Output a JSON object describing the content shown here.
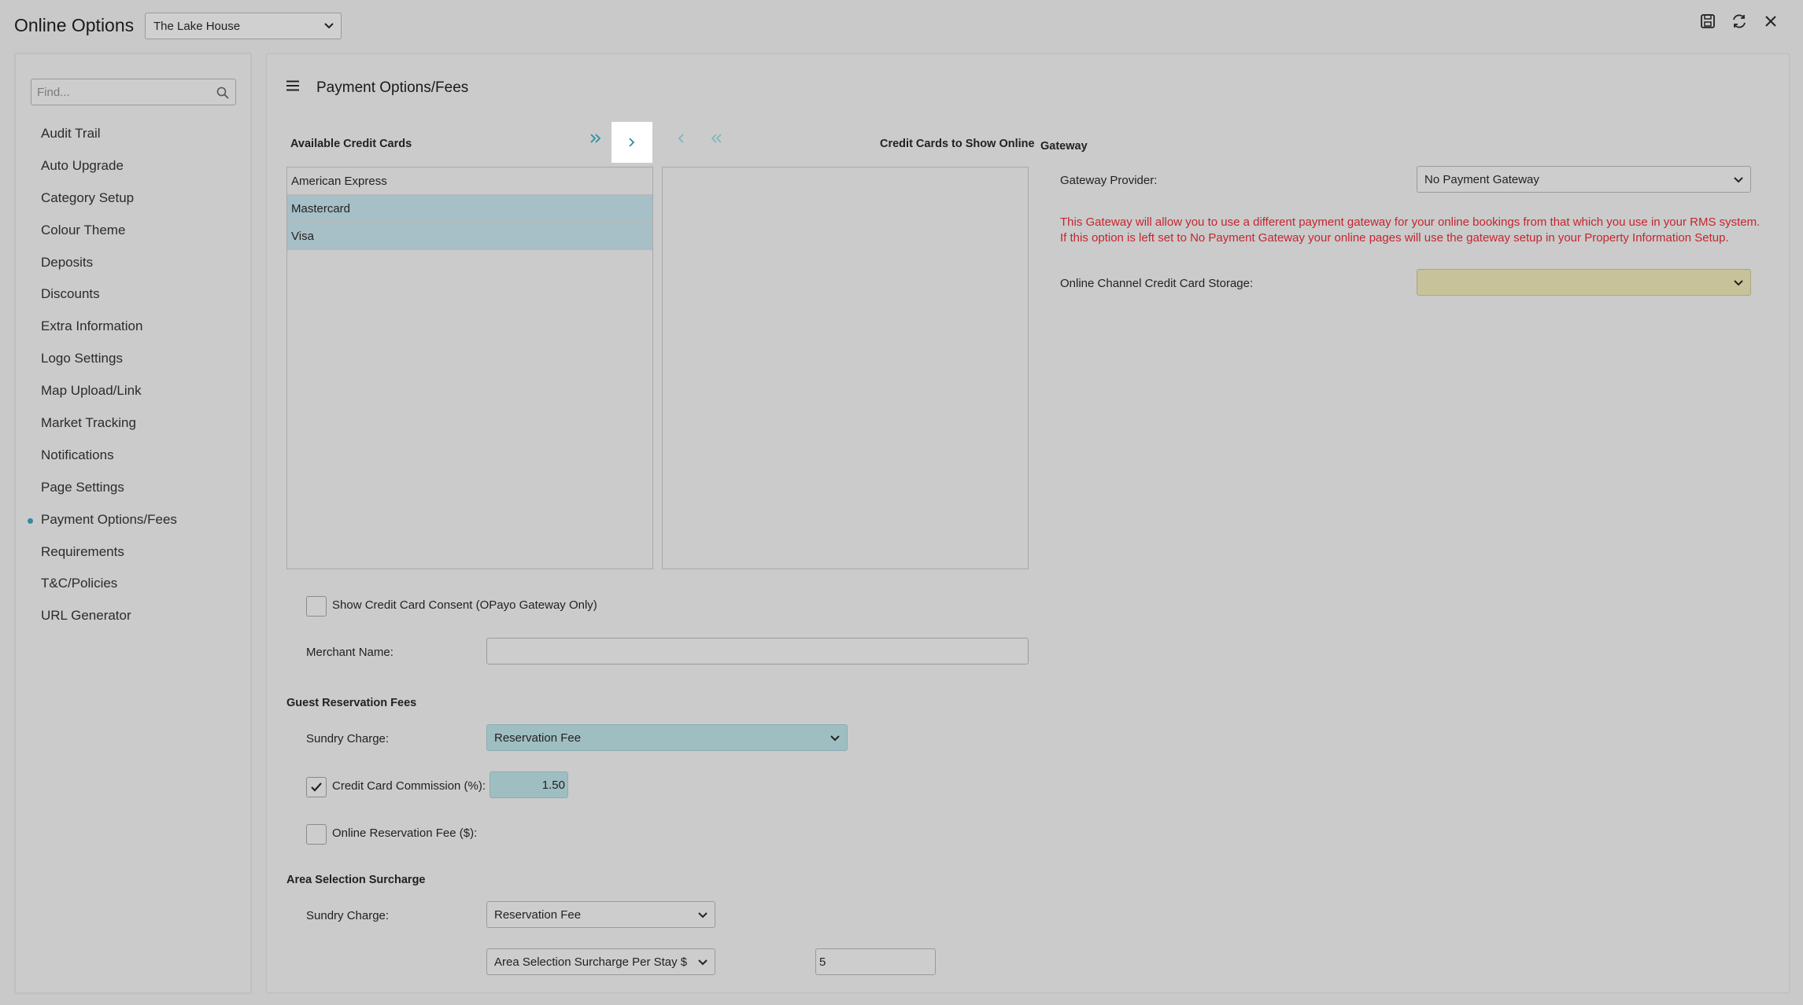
{
  "app": {
    "title": "Online Options",
    "property": "The Lake House"
  },
  "sidebar": {
    "search_placeholder": "Find...",
    "items": [
      {
        "label": "Audit Trail"
      },
      {
        "label": "Auto Upgrade"
      },
      {
        "label": "Category Setup"
      },
      {
        "label": "Colour Theme"
      },
      {
        "label": "Deposits"
      },
      {
        "label": "Discounts"
      },
      {
        "label": "Extra Information"
      },
      {
        "label": "Logo Settings"
      },
      {
        "label": "Map Upload/Link"
      },
      {
        "label": "Market Tracking"
      },
      {
        "label": "Notifications"
      },
      {
        "label": "Page Settings"
      },
      {
        "label": "Payment Options/Fees",
        "active": true
      },
      {
        "label": "Requirements"
      },
      {
        "label": "T&C/Policies"
      },
      {
        "label": "URL Generator"
      }
    ]
  },
  "main": {
    "title": "Payment Options/Fees",
    "available_cards_label": "Available Credit Cards",
    "show_online_label": "Credit Cards to Show Online",
    "available_cards": [
      {
        "name": "American Express",
        "selected": false
      },
      {
        "name": "Mastercard",
        "selected": true
      },
      {
        "name": "Visa",
        "selected": true
      }
    ],
    "show_online_cards": [],
    "consent_label": "Show Credit Card Consent (OPayo Gateway Only)",
    "consent_checked": false,
    "merchant_name_label": "Merchant Name:",
    "merchant_name_value": "",
    "guest_fees_heading": "Guest Reservation Fees",
    "sundry_charge_label": "Sundry Charge:",
    "guest_sundry_value": "Reservation Fee",
    "cc_commission_label": "Credit Card Commission (%):",
    "cc_commission_checked": true,
    "cc_commission_value": "1.50",
    "online_fee_label": "Online Reservation Fee ($):",
    "online_fee_checked": false,
    "area_heading": "Area Selection Surcharge",
    "area_sundry_value": "Reservation Fee",
    "area_type_value": "Area Selection Surcharge Per Stay $",
    "area_amount_value": "5"
  },
  "gateway": {
    "heading": "Gateway",
    "provider_label": "Gateway Provider:",
    "provider_value": "No Payment Gateway",
    "warning_text": "This Gateway will allow you to use a different payment gateway for your online bookings from that which you use in your RMS system. If this option is left set to No Payment Gateway your online pages will use the gateway setup in your Property Information Setup.",
    "storage_label": "Online Channel Credit Card Storage:",
    "storage_value": ""
  },
  "colors": {
    "accent": "#2d8fa0",
    "warning": "#c4262e",
    "selected_row": "#a7bfc6"
  }
}
